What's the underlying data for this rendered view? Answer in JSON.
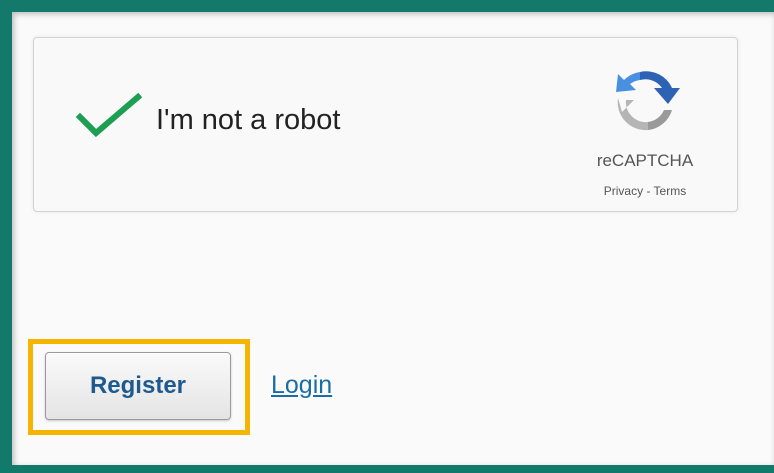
{
  "captcha": {
    "label": "I'm not a robot",
    "checked": true,
    "brand": "reCAPTCHA",
    "links": "Privacy - Terms",
    "check_color": "#1e9e52"
  },
  "actions": {
    "register_label": "Register",
    "login_label": "Login"
  },
  "colors": {
    "frame": "#137a6b",
    "highlight": "#f5b400",
    "link": "#1a6ca8",
    "button_text": "#1f5a8f"
  }
}
